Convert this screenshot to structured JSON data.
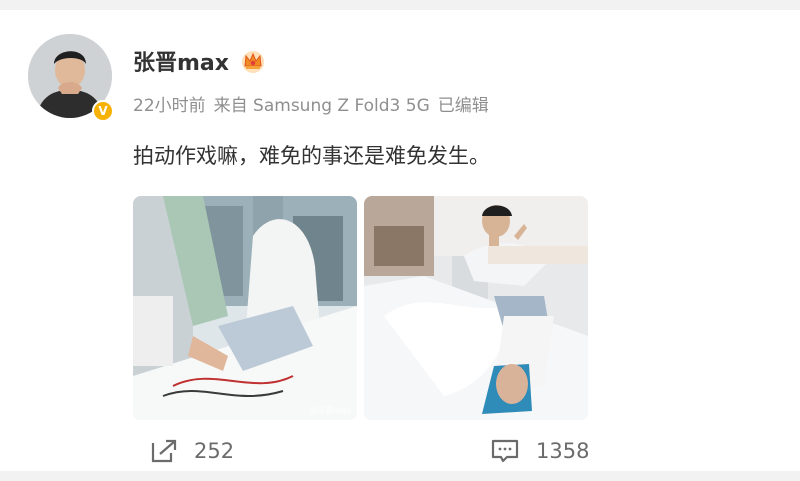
{
  "post": {
    "username": "张晋max",
    "verified_badge": "V",
    "time": "22小时前",
    "source": "来自 Samsung Z Fold3 5G",
    "edited": "已编辑",
    "text": "拍动作戏嘛，难免的事还是难免发生。",
    "photo_watermark": "@张晋max"
  },
  "actions": {
    "repost_count": "252",
    "comment_count": "1358"
  },
  "icons": {
    "repost": "share-arrow-icon",
    "comment": "comment-bubble-icon",
    "crown": "crown-badge-icon"
  },
  "colors": {
    "text_primary": "#333333",
    "text_secondary": "#8f8f8f",
    "verified": "#f7b100",
    "background": "#f2f2f2"
  }
}
